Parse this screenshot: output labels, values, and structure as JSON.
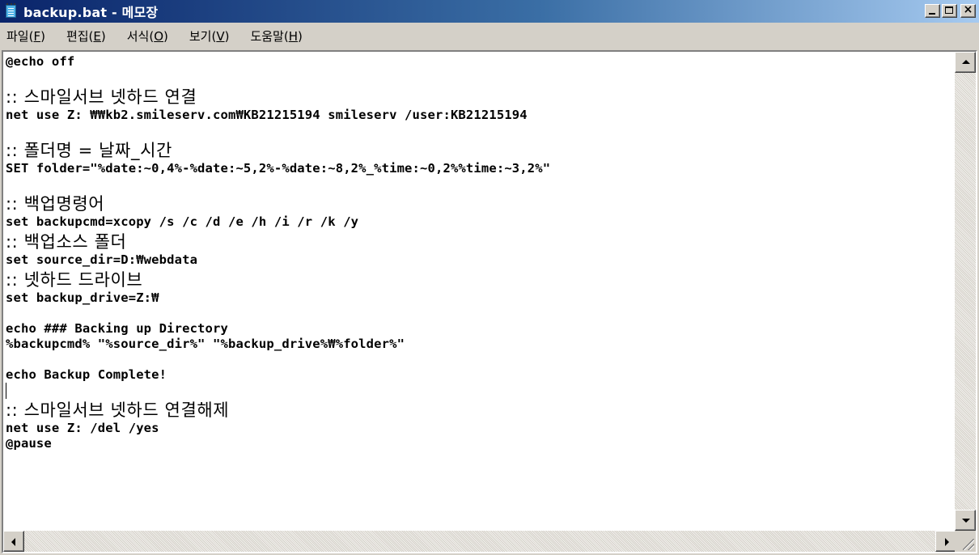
{
  "window": {
    "title": "backup.bat - 메모장",
    "icon": "notepad-icon"
  },
  "menu": [
    {
      "label": "파일(",
      "key": "F",
      "tail": ")"
    },
    {
      "label": "편집(",
      "key": "E",
      "tail": ")"
    },
    {
      "label": "서식(",
      "key": "O",
      "tail": ")"
    },
    {
      "label": "보기(",
      "key": "V",
      "tail": ")"
    },
    {
      "label": "도움말(",
      "key": "H",
      "tail": ")"
    }
  ],
  "editor": {
    "lines": [
      "@echo off",
      "",
      ":: 스마일서브 넷하드 연결",
      "net use Z: ₩₩kb2.smileserv.com₩KB21215194 smileserv /user:KB21215194",
      "",
      ":: 폴더명 = 날짜_시간",
      "SET folder=\"%date:~0,4%-%date:~5,2%-%date:~8,2%_%time:~0,2%%time:~3,2%\"",
      "",
      ":: 백업명령어",
      "set backupcmd=xcopy /s /c /d /e /h /i /r /k /y",
      ":: 백업소스 폴더",
      "set source_dir=D:₩webdata",
      ":: 넷하드 드라이브",
      "set backup_drive=Z:₩",
      "",
      "echo ### Backing up Directory",
      "%backupcmd% \"%source_dir%\" \"%backup_drive%₩%folder%\"",
      "",
      "echo Backup Complete!",
      "",
      ":: 스마일서브 넷하드 연결해제",
      "net use Z: /del /yes",
      "@pause"
    ]
  }
}
